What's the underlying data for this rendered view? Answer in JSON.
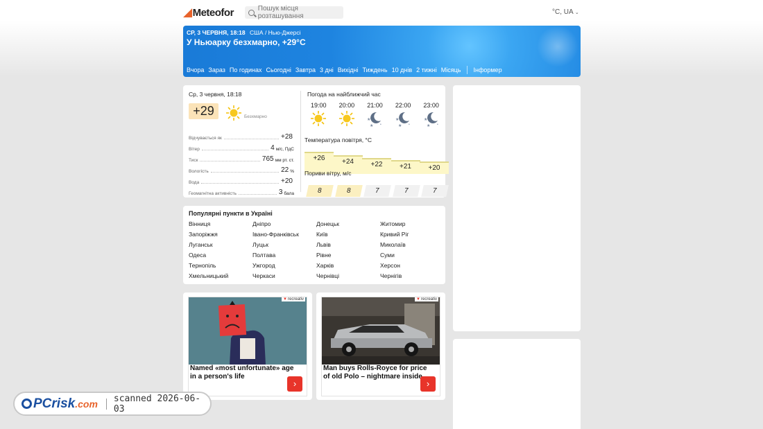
{
  "header": {
    "logo": "Meteofor",
    "search_placeholder": "Пошук місця розташування",
    "units": "°C, UA"
  },
  "hero": {
    "date": "СР, 3 ЧЕРВНЯ, 18:18",
    "location": "США / Нью-Джерсі",
    "headline": "У Ньюарку безхмарно,  +29°C",
    "nav": [
      "Вчора",
      "Зараз",
      "По годинах",
      "Сьогодні",
      "Завтра",
      "3 дні",
      "Вихідні",
      "Тиждень",
      "10 днів",
      "2 тижні",
      "Місяць"
    ],
    "nav_extra": "Інформер"
  },
  "current": {
    "date": "Ср, 3 червня, 18:18",
    "temp": "+29",
    "condition": "Безхмарно",
    "rows": [
      {
        "label": "Відчувається як",
        "value": "+28",
        "unit": ""
      },
      {
        "label": "Вітер",
        "value": "4",
        "unit": "м/с, ПдС"
      },
      {
        "label": "Тиск",
        "value": "765",
        "unit": "мм рт. ст."
      },
      {
        "label": "Вологість",
        "value": "22",
        "unit": "%"
      },
      {
        "label": "Вода",
        "value": "+20",
        "unit": ""
      },
      {
        "label": "Геомагнітна активність",
        "value": "3",
        "unit": "бала"
      }
    ]
  },
  "nearest": {
    "title": "Погода  на найближчий час",
    "hours": [
      "19:00",
      "20:00",
      "21:00",
      "22:00",
      "23:00"
    ],
    "icons": [
      "sun-icon",
      "sun-icon",
      "moon-icon",
      "moon-icon",
      "moon-icon"
    ],
    "temp_title": "Температура повітря, °C",
    "temps": [
      "+26",
      "+24",
      "+22",
      "+21",
      "+20"
    ],
    "wind_title": "Пориви вітру, м/с",
    "gusts": [
      "8",
      "8",
      "7",
      "7",
      "7"
    ]
  },
  "popular": {
    "title": "Популярні пункти в Україні",
    "cities": [
      "Вінниця",
      "Дніпро",
      "Донецьк",
      "Житомир",
      "Запоріжжя",
      "Івано-Франківськ",
      "Київ",
      "Кривий Ріг",
      "Луганськ",
      "Луцьк",
      "Львів",
      "Миколаїв",
      "Одеса",
      "Полтава",
      "Рівне",
      "Суми",
      "Тернопіль",
      "Ужгород",
      "Харків",
      "Херсон",
      "Хмельницький",
      "Черкаси",
      "Чернівці",
      "Чернігів"
    ]
  },
  "ads": [
    {
      "brand": "recreativ",
      "title": "Named «most unfortunate» age in a person's life"
    },
    {
      "brand": "recreativ",
      "title": "Man buys Rolls-Royce for price of old Polo – nightmare inside"
    }
  ],
  "watermark": {
    "logo_pc": "PC",
    "logo_rest": "risk",
    "logo_tld": ".com",
    "text": "scanned 2026-06-03"
  },
  "colors": {
    "accent": "#1e84e0",
    "temp_box": "#fbe3b8",
    "bar_fill": "#fdf7c8",
    "ad_button": "#e8342a"
  }
}
